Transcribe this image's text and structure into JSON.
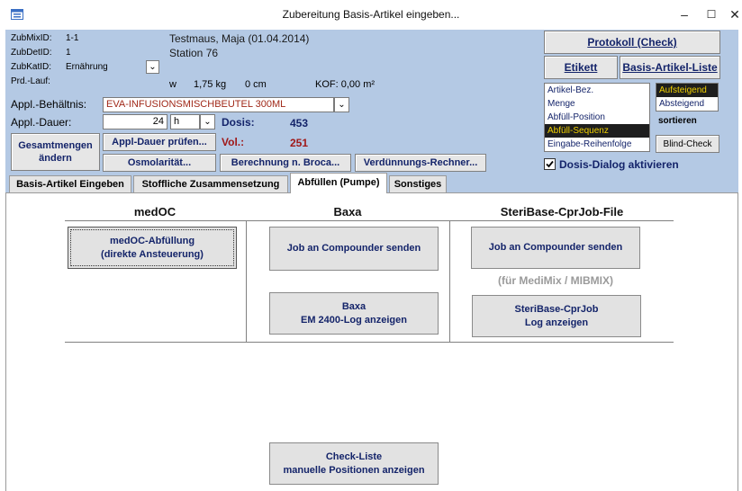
{
  "window": {
    "title": "Zubereitung Basis-Artikel eingeben...",
    "controls": {
      "minimize": "–",
      "maximize": "☐",
      "close": "✕"
    }
  },
  "header": {
    "zubmixid_label": "ZubMixID:",
    "zubmixid_value": "1-1",
    "zubdetid_label": "ZubDetID:",
    "zubdetid_value": "1",
    "zubkatid_label": "ZubKatID:",
    "zubkatid_value": "Ernährung",
    "prdlauf_label": "Prd.-Lauf:",
    "patient_name": "Testmaus, Maja (01.04.2014)",
    "station": "Station 76",
    "weight_unit": "w",
    "weight": "1,75 kg",
    "height": "0 cm",
    "kof": "KOF: 0,00 m²",
    "behaeltnis_label": "Appl.-Behältnis:",
    "behaeltnis_value": "EVA-INFUSIONSMISCHBEUTEL 300ML",
    "dauer_label": "Appl.-Dauer:",
    "dauer_value": "24",
    "dauer_unit": "h",
    "dosis_label": "Dosis:",
    "dosis_value": "453",
    "vol_label": "Vol.:",
    "vol_value": "251"
  },
  "buttons": {
    "gesamtmengen": "Gesamtmengen\nändern",
    "appl_dauer_pruefen": "Appl-Dauer prüfen...",
    "osmolaritaet": "Osmolarität...",
    "berechnung_broca": "Berechnung n. Broca...",
    "verduennungs_rechner": "Verdünnungs-Rechner...",
    "protokoll": "Protokoll (Check)",
    "etikett": "Etikett",
    "basis_artikel_liste": "Basis-Artikel-Liste",
    "blind_check": "Blind-Check"
  },
  "sort": {
    "items": [
      "Artikel-Bez.",
      "Menge",
      "Abfüll-Position",
      "Abfüll-Sequenz",
      "Eingabe-Reihenfolge"
    ],
    "selected": "Abfüll-Sequenz",
    "order": [
      "Aufsteigend",
      "Absteigend"
    ],
    "order_selected": "Aufsteigend",
    "label": "sortieren"
  },
  "dosis_dialog": {
    "label": "Dosis-Dialog aktivieren",
    "checked": true
  },
  "tabs": [
    {
      "label": "Basis-Artikel Eingeben",
      "active": false
    },
    {
      "label": "Stoffliche Zusammensetzung",
      "active": false
    },
    {
      "label": "Abfüllen (Pumpe)",
      "active": true
    },
    {
      "label": "Sonstiges",
      "active": false
    }
  ],
  "sections": {
    "medoc": {
      "title": "medOC",
      "button": "medOC-Abfüllung\n(direkte Ansteuerung)"
    },
    "baxa": {
      "title": "Baxa",
      "send_button": "Job an Compounder senden",
      "log_button": "Baxa\nEM 2400-Log anzeigen"
    },
    "steribase": {
      "title": "SteriBase-CprJob-File",
      "send_button": "Job an Compounder senden",
      "note": "(für MediMix / MIBMIX)",
      "log_button": "SteriBase-CprJob\nLog anzeigen"
    },
    "checkliste": {
      "button": "Check-Liste\nmanuelle Positionen anzeigen"
    }
  },
  "colors": {
    "header_bg": "#b4c9e4",
    "accent": "#14246a",
    "vol_color": "#a01818"
  }
}
